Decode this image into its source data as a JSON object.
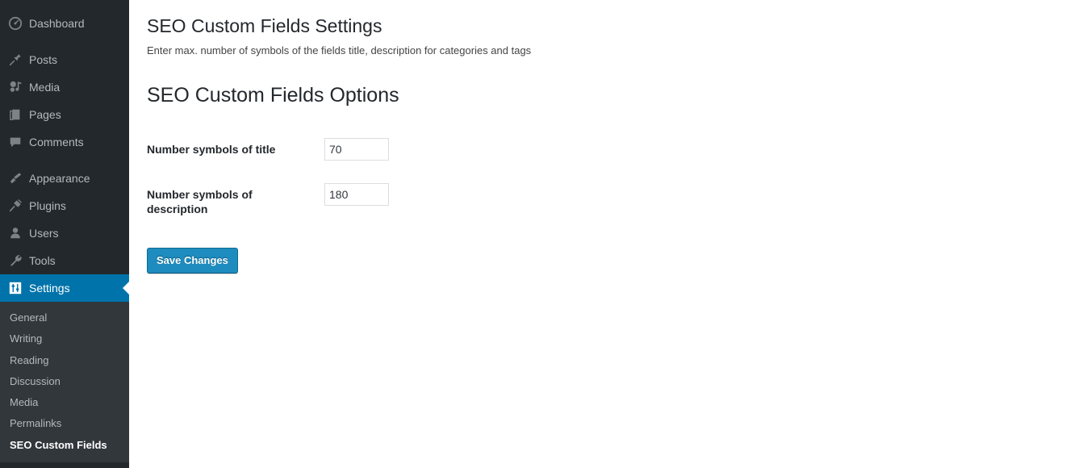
{
  "sidebar": {
    "items": [
      {
        "label": "Dashboard",
        "icon": "dashboard-icon",
        "name": "dashboard",
        "group": 0
      },
      {
        "label": "Posts",
        "icon": "pin-icon",
        "name": "posts",
        "group": 1
      },
      {
        "label": "Media",
        "icon": "media-icon",
        "name": "media",
        "group": 1
      },
      {
        "label": "Pages",
        "icon": "pages-icon",
        "name": "pages",
        "group": 1
      },
      {
        "label": "Comments",
        "icon": "comments-icon",
        "name": "comments",
        "group": 1
      },
      {
        "label": "Appearance",
        "icon": "appearance-brush-icon",
        "name": "appearance",
        "group": 2
      },
      {
        "label": "Plugins",
        "icon": "plugins-plug-icon",
        "name": "plugins",
        "group": 2
      },
      {
        "label": "Users",
        "icon": "users-icon",
        "name": "users",
        "group": 2
      },
      {
        "label": "Tools",
        "icon": "tools-wrench-icon",
        "name": "tools",
        "group": 2
      },
      {
        "label": "Settings",
        "icon": "settings-sliders-icon",
        "name": "settings",
        "group": 2,
        "current": true
      }
    ],
    "submenu": [
      {
        "label": "General",
        "name": "general"
      },
      {
        "label": "Writing",
        "name": "writing"
      },
      {
        "label": "Reading",
        "name": "reading"
      },
      {
        "label": "Discussion",
        "name": "discussion"
      },
      {
        "label": "Media",
        "name": "media"
      },
      {
        "label": "Permalinks",
        "name": "permalinks"
      },
      {
        "label": "SEO Custom Fields",
        "name": "seo-custom-fields",
        "current": true
      }
    ],
    "colors": {
      "background": "#23282d",
      "submenu_background": "#32373c",
      "current_highlight": "#0073aa",
      "label": "#b4b9be"
    }
  },
  "main": {
    "page_title": "SEO Custom Fields Settings",
    "page_description": "Enter max. number of symbols of the fields title, description for categories and tags",
    "section_title": "SEO Custom Fields Options",
    "fields": [
      {
        "label": "Number symbols of title",
        "value": "70",
        "name": "number-symbols-of-title"
      },
      {
        "label": "Number symbols of description",
        "value": "180",
        "name": "number-symbols-of-description"
      }
    ],
    "submit_label": "Save Changes",
    "colors": {
      "button_primary": "#1e8cbe",
      "button_border": "#0e6a93",
      "text": "#23282d",
      "input_border": "#dddddd"
    }
  }
}
